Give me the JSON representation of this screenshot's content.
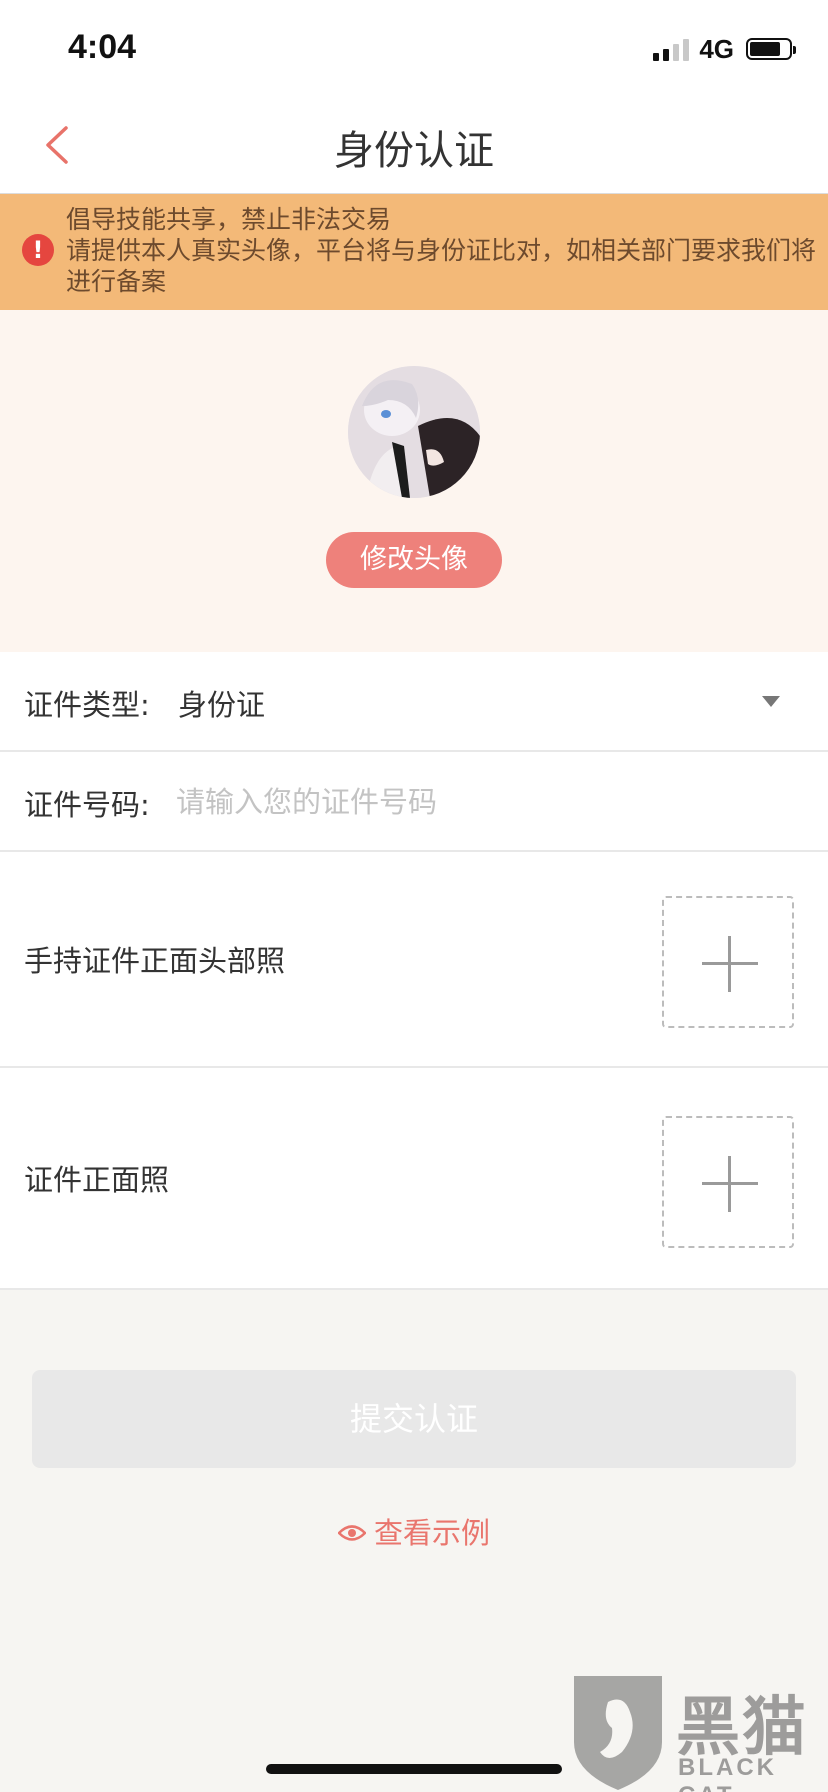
{
  "status_bar": {
    "time": "4:04",
    "network": "4G",
    "signal_bars": 2,
    "battery_level": 0.8
  },
  "nav": {
    "title": "身份认证",
    "back_icon": "chevron-left-icon"
  },
  "notice": {
    "icon": "alert-icon",
    "line1": "倡导技能共享，禁止非法交易",
    "line2": "请提供本人真实头像，平台将与身份证比对，如相关部门要求我们将进行备案"
  },
  "avatar": {
    "change_label": "修改头像"
  },
  "form": {
    "id_type_label": "证件类型:",
    "id_type_value": "身份证",
    "id_number_label": "证件号码:",
    "id_number_placeholder": "请输入您的证件号码",
    "id_number_value": "",
    "hand_photo_label": "手持证件正面头部照",
    "front_photo_label": "证件正面照"
  },
  "submit_label": "提交认证",
  "example_label": "查看示例",
  "watermark": {
    "cn": "黑猫",
    "en": "BLACK CAT"
  },
  "colors": {
    "accent": "#ee817b",
    "notice_bg": "#f3b978",
    "notice_text": "#6d4a2d",
    "avatar_bg": "#fdf5ef",
    "link": "#e9756d"
  }
}
